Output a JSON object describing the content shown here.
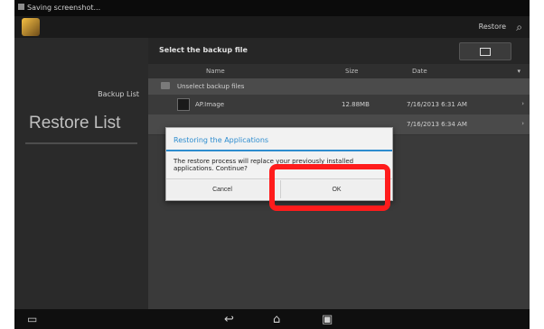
{
  "statusbar": {
    "text": "Saving screenshot..."
  },
  "actionbar": {
    "right_text": "Restore",
    "icon": "search-icon"
  },
  "sidebar": {
    "subtitle": "Backup List",
    "title": "Restore List"
  },
  "main": {
    "header_title": "Select the backup file",
    "columns": [
      "Name",
      "Size",
      "Date"
    ],
    "folder_row": "Unselect backup files",
    "rows": [
      {
        "name": "AP.Image",
        "size": "12.88MB",
        "date": "7/16/2013 6:31 AM"
      },
      {
        "name": "",
        "size": "",
        "date": "7/16/2013 6:34 AM"
      }
    ]
  },
  "dialog": {
    "title": "Restoring the Applications",
    "message": "The restore process will replace your previously installed applications. Continue?",
    "cancel": "Cancel",
    "ok": "OK"
  },
  "colors": {
    "dialog_accent": "#2d8ccf",
    "highlight": "#ff1c1c"
  }
}
